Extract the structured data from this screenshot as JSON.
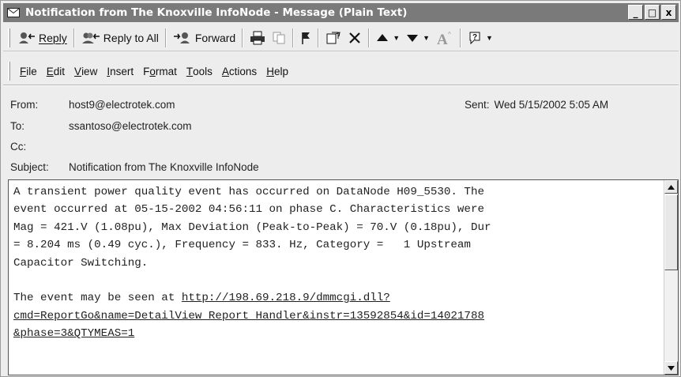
{
  "window": {
    "title": "Notification from The Knoxville InfoNode - Message (Plain Text)",
    "buttons": {
      "minimize": "_",
      "maximize": "□",
      "close": "x"
    }
  },
  "toolbar": {
    "reply": "Reply",
    "reply_all": "Reply to All",
    "forward": "Forward"
  },
  "menu": [
    {
      "label": "File",
      "key": "F",
      "rest": "ile"
    },
    {
      "label": "Edit",
      "key": "E",
      "rest": "dit"
    },
    {
      "label": "View",
      "key": "V",
      "rest": "iew"
    },
    {
      "label": "Insert",
      "key": "I",
      "rest": "nsert"
    },
    {
      "label": "Format",
      "pre": "F",
      "key": "o",
      "rest": "rmat"
    },
    {
      "label": "Tools",
      "key": "T",
      "rest": "ools"
    },
    {
      "label": "Actions",
      "key": "A",
      "rest": "ctions"
    },
    {
      "label": "Help",
      "key": "H",
      "rest": "elp"
    }
  ],
  "header": {
    "from_label": "From:",
    "from": "host9@electrotek.com",
    "to_label": "To:",
    "to": "ssantoso@electrotek.com",
    "cc_label": "Cc:",
    "cc": "",
    "subject_label": "Subject:",
    "subject": "Notification from The Knoxville InfoNode",
    "sent_label": "Sent:",
    "sent": "Wed 5/15/2002 5:05 AM"
  },
  "body": {
    "paragraph1": [
      "A transient power quality event has occurred on DataNode H09_5530. The",
      "event occurred at 05-15-2002 04:56:11 on phase C. Characteristics were",
      "Mag = 421.V (1.08pu), Max Deviation (Peak-to-Peak) = 70.V (0.18pu), Dur",
      "= 8.204 ms (0.49 cyc.), Frequency = 833. Hz, Category =   1 Upstream",
      "Capacitor Switching."
    ],
    "link_intro": "The event may be seen at ",
    "link_lines": [
      "http://198.69.218.9/dmmcgi.dll?",
      "cmd=ReportGo&name=DetailView Report Handler&instr=13592854&id=14021788",
      "&phase=3&QTYMEAS=1"
    ]
  }
}
